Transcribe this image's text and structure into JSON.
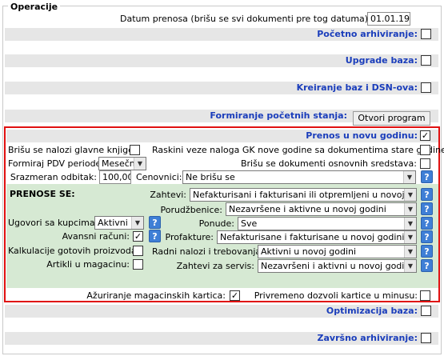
{
  "groupbox": {
    "title": "Operacije"
  },
  "datum": {
    "label": "Datum prenosa (brišu se svi dokumenti pre tog datuma):",
    "value": "01.01.19"
  },
  "bands": {
    "pocetno": {
      "label": "Početno arhiviranje:",
      "checked": ""
    },
    "upgrade": {
      "label": "Upgrade baza:",
      "checked": ""
    },
    "kreiranje": {
      "label": "Kreiranje baz i DSN-ova:",
      "checked": ""
    },
    "formiranje": {
      "label": "Formiranje početnih stanja:",
      "button": "Otvori program"
    },
    "prenos": {
      "label": "Prenos u novu godinu:",
      "checked": "✓"
    },
    "optimizacija": {
      "label": "Optimizacija baza:",
      "checked": ""
    },
    "zavrsno": {
      "label": "Završno arhiviranje:",
      "checked": ""
    }
  },
  "prenos_opts": {
    "brisu_naloge": {
      "label": "Brišu se nalozi glavne knjige:",
      "checked": ""
    },
    "raskini_veze": {
      "label": "Raskini veze naloga GK nove godine sa dokumentima stare godine:",
      "checked": ""
    },
    "formiraj_pdv": {
      "label": "Formiraj PDV periode:",
      "value": "Mesečni"
    },
    "brisu_osnovna": {
      "label": "Brišu se dokumenti osnovnih sredstava:",
      "checked": ""
    },
    "srazmeran": {
      "label": "Srazmeran odbitak:",
      "value": "100,00"
    },
    "cenovnici": {
      "label": "Cenovnici:",
      "value": "Ne brišu se"
    }
  },
  "prenose_se": {
    "title": "PRENOSE SE:",
    "zahtevi": {
      "label": "Zahtevi:",
      "value": "Nefakturisani i fakturisani ili otpremljeni u novoj g."
    },
    "porudzbenice": {
      "label": "Porudžbenice:",
      "value": "Nezavršene i aktivne u novoj godini"
    },
    "ugovori": {
      "label": "Ugovori sa kupcima:",
      "value": "Aktivni"
    },
    "ponude": {
      "label": "Ponude:",
      "value": "Sve"
    },
    "avansni": {
      "label": "Avansni računi:",
      "checked": "✓"
    },
    "profakture": {
      "label": "Profakture:",
      "value": "Nefakturisane i fakturisane u novoj godini"
    },
    "kalkulacije": {
      "label": "Kalkulacije gotovih proizvoda:",
      "checked": ""
    },
    "radni_nalozi": {
      "label": "Radni nalozi i trebovanja:",
      "value": "Aktivni u novoj godini"
    },
    "artikli": {
      "label": "Artikli u magacinu:",
      "checked": ""
    },
    "zahtevi_servis": {
      "label": "Zahtevi za servis:",
      "value": "Nezavršeni i aktivni u novoj godini"
    }
  },
  "bottom_opts": {
    "azuriranje": {
      "label": "Ažuriranje magacinskih kartica:",
      "checked": "✓"
    },
    "privremeno": {
      "label": "Privremeno dozvoli kartice u minusu:",
      "checked": ""
    }
  },
  "help_glyph": "?",
  "dropdown_glyph": "▼"
}
